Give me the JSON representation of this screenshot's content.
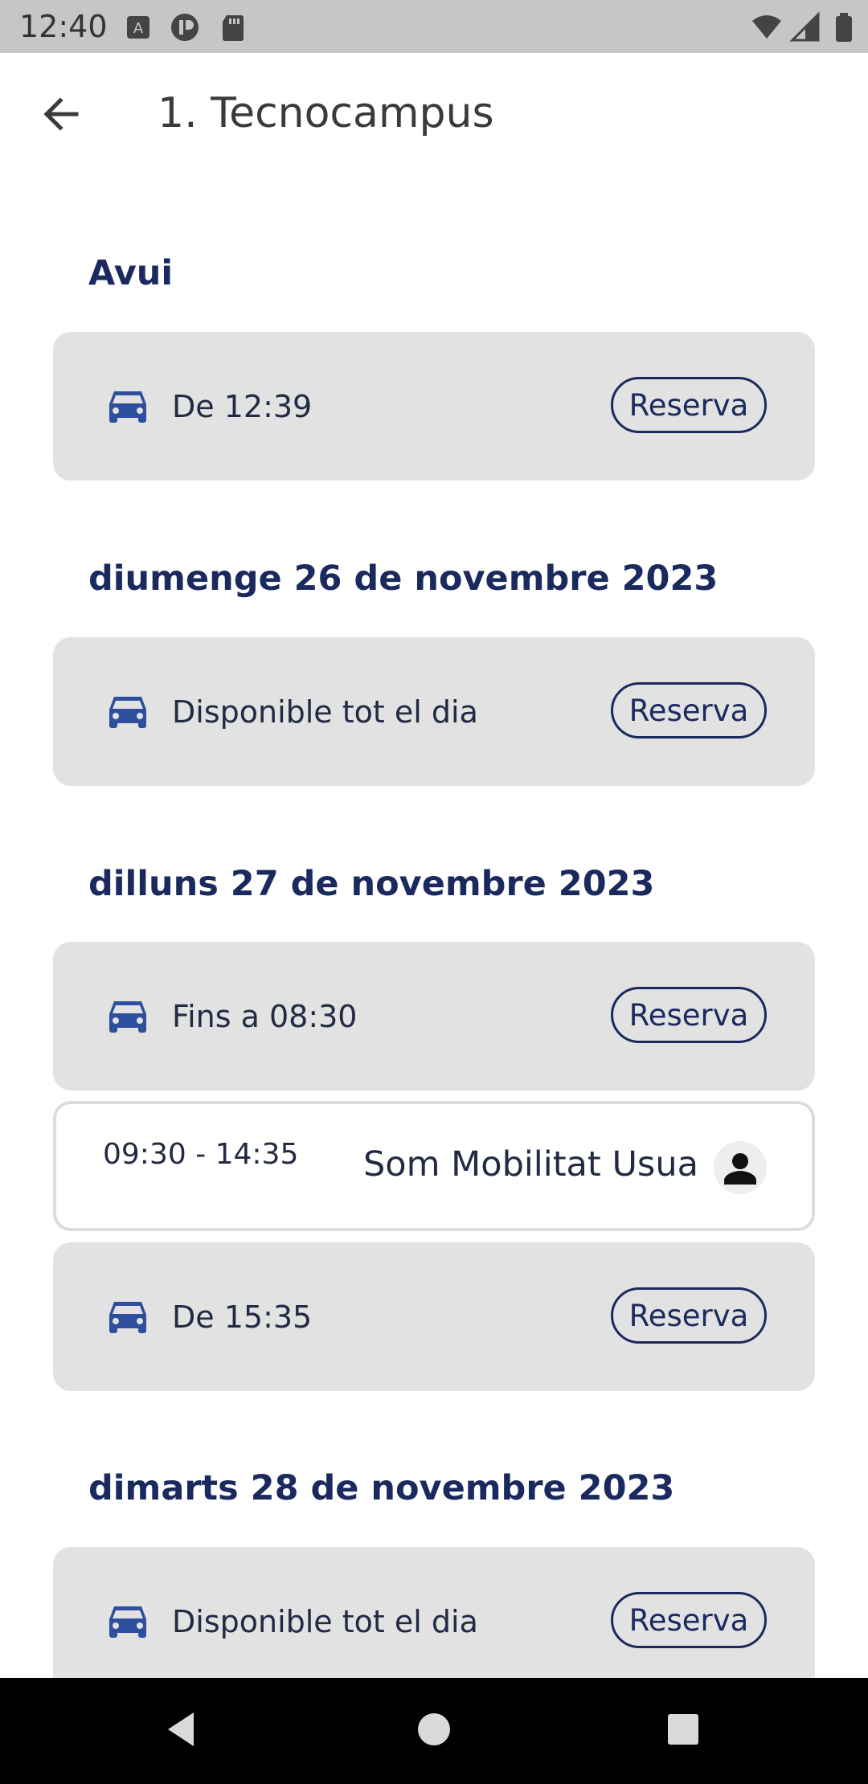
{
  "status_bar": {
    "time": "12:40",
    "icons_left": [
      "keyboard-a-icon",
      "vpn-icon",
      "sd-card-icon"
    ],
    "icons_right": [
      "wifi-icon",
      "signal-icon",
      "battery-icon"
    ]
  },
  "app_bar": {
    "title": "1. Tecnocampus",
    "back_icon": "arrow-left-icon"
  },
  "schedule": {
    "days": [
      {
        "heading": "Avui",
        "slots": [
          {
            "type": "available",
            "label": "De 12:39",
            "button": "Reserva"
          }
        ]
      },
      {
        "heading": "diumenge 26 de novembre 2023",
        "slots": [
          {
            "type": "available",
            "label": "Disponible tot el dia",
            "button": "Reserva"
          }
        ]
      },
      {
        "heading": "dilluns 27 de novembre 2023",
        "slots": [
          {
            "type": "available",
            "label": "Fins a 08:30",
            "button": "Reserva"
          },
          {
            "type": "booked",
            "time": "09:30 - 14:35",
            "user": "Som Mobilitat Usua"
          },
          {
            "type": "available",
            "label": "De 15:35",
            "button": "Reserva"
          }
        ]
      },
      {
        "heading": "dimarts 28 de novembre 2023",
        "slots": [
          {
            "type": "available",
            "label": "Disponible tot el dia",
            "button": "Reserva"
          }
        ]
      }
    ]
  },
  "nav_bar": {
    "buttons": [
      "back-triangle-icon",
      "home-circle-icon",
      "recents-square-icon"
    ]
  },
  "colors": {
    "accent": "#1b2a5e",
    "car_icon": "#2d4f9e",
    "card_bg": "#e2e2e2"
  }
}
